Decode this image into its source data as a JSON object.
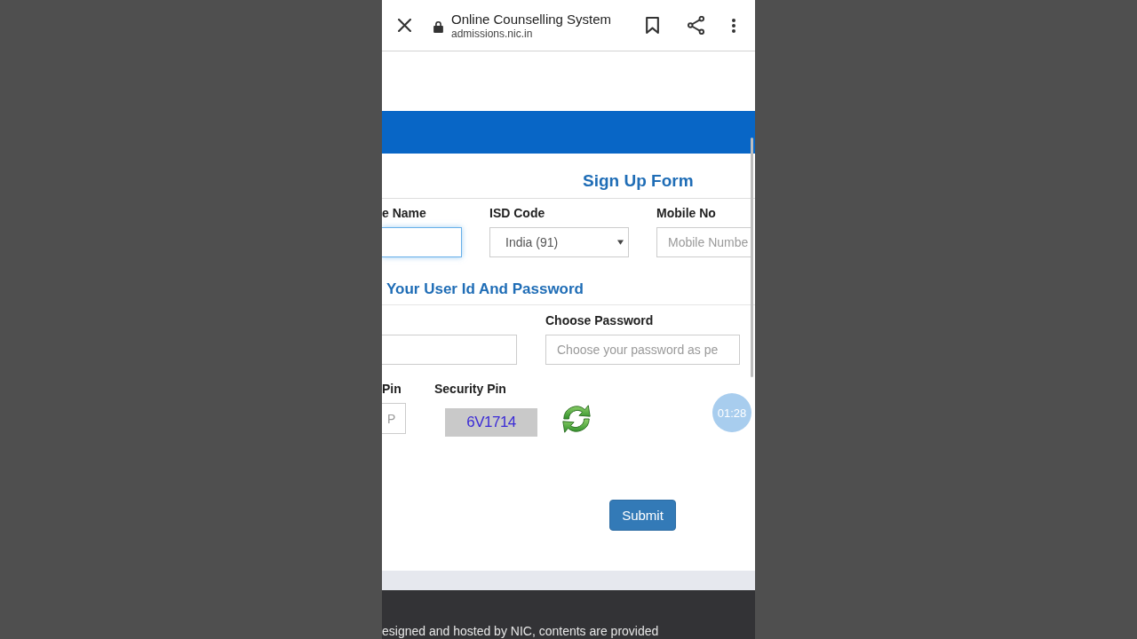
{
  "browser": {
    "title": "Online Counselling System",
    "url": "admissions.nic.in"
  },
  "form": {
    "title": "Sign Up Form",
    "contact_fields": [
      {
        "kind": "text",
        "label": "e Name",
        "focused": true
      },
      {
        "kind": "select",
        "label": "ISD Code",
        "value": "India (91)"
      },
      {
        "kind": "text",
        "label": "Mobile No",
        "placeholder": "Mobile Numbe",
        "focused": false
      }
    ],
    "account_heading": "Your User Id And Password",
    "account_fields": [
      {
        "focused": false
      },
      {
        "label": "Choose Password",
        "placeholder": "Choose your password as pe",
        "focused": false
      }
    ],
    "pin_field": {
      "label": "Pin",
      "placeholder": "P",
      "focused": false
    },
    "security_pin": {
      "label": "Security Pin",
      "captcha": "6V1714"
    },
    "submit_button": "Submit"
  },
  "recording_timer": "01:28",
  "footer": {
    "text": "esigned and hosted by NIC, contents are provided"
  }
}
